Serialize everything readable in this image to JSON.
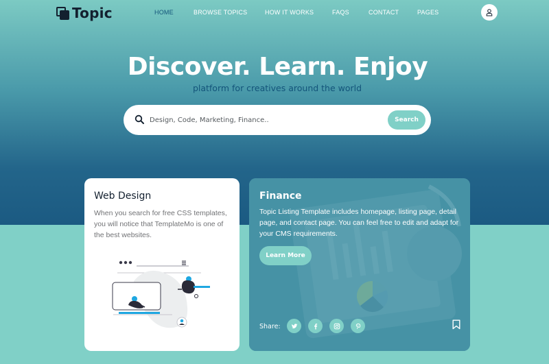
{
  "brand": {
    "name": "Topic"
  },
  "nav": {
    "items": [
      "HOME",
      "BROWSE TOPICS",
      "HOW IT WORKS",
      "FAQS",
      "CONTACT",
      "PAGES"
    ],
    "active": "HOME"
  },
  "hero": {
    "title": "Discover. Learn. Enjoy",
    "subtitle": "platform for creatives around the world"
  },
  "search": {
    "placeholder": "Design, Code, Marketing, Finance..",
    "button_label": "Search"
  },
  "cards": [
    {
      "title": "Web Design",
      "description": "When you search for free CSS templates, you will notice that TemplateMo is one of the best websites."
    },
    {
      "title": "Finance",
      "description": "Topic Listing Template includes homepage, listing page, detail page, and contact page. You can feel free to edit and adapt for your CMS requirements.",
      "button_label": "Learn More",
      "share_label": "Share:"
    }
  ],
  "icons": {
    "search": "search-icon",
    "user": "user-icon",
    "social": [
      "twitter-icon",
      "facebook-icon",
      "instagram-icon",
      "pinterest-icon"
    ],
    "bookmark": "bookmark-icon"
  },
  "colors": {
    "primary": "#13547a",
    "secondary": "#80d0c7",
    "dark": "#13202f",
    "white": "#ffffff"
  }
}
